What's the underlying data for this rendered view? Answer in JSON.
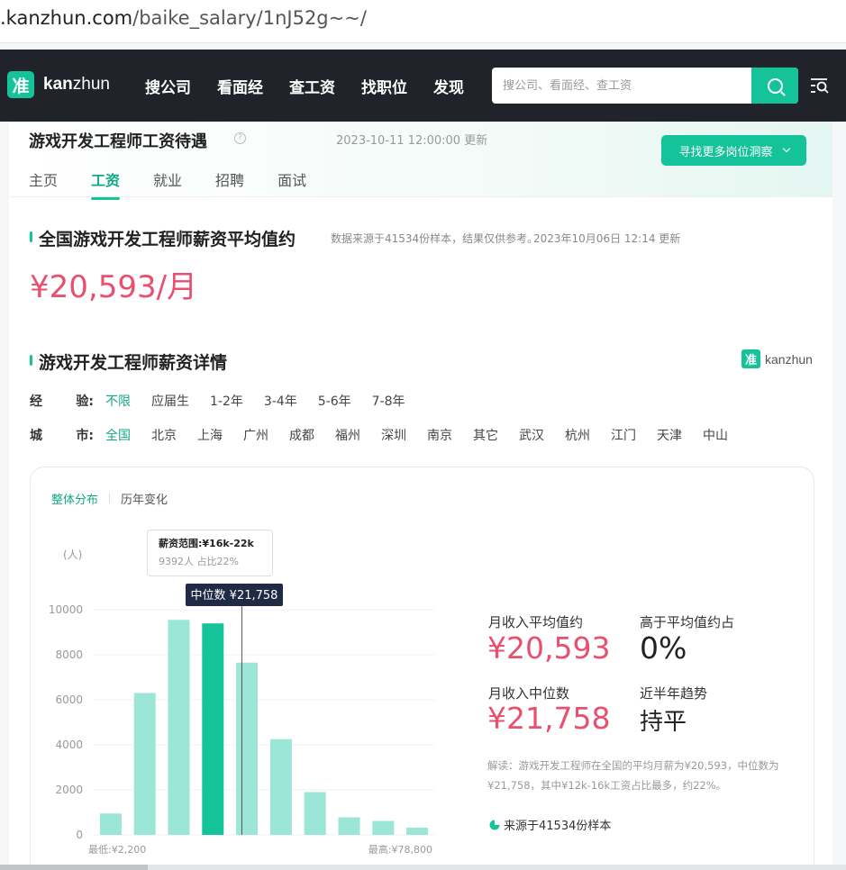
{
  "browser": {
    "url_host": ".kanzhun.com",
    "url_path": "/baike_salary/1nJ52g~~/"
  },
  "nav": {
    "logo_mark": "准",
    "logo_bold": "kan",
    "logo_rest": "zhun",
    "links": [
      "搜公司",
      "看面经",
      "查工资",
      "找职位",
      "发现"
    ],
    "search_placeholder": "搜公司、看面经、查工资"
  },
  "header": {
    "title": "游戏开发工程师工资待遇",
    "update_time": "2023-10-11 12:00:00 更新",
    "more_button": "寻找更多岗位洞察",
    "tabs": [
      {
        "label": "主页",
        "active": false
      },
      {
        "label": "工资",
        "active": true
      },
      {
        "label": "就业",
        "active": false
      },
      {
        "label": "招聘",
        "active": false
      },
      {
        "label": "面试",
        "active": false
      }
    ]
  },
  "average": {
    "title": "全国游戏开发工程师薪资平均值约",
    "note": "数据来源于41534份样本，结果仅供参考。",
    "date": "2023年10月06日 12:14 更新",
    "value": "¥20,593/月"
  },
  "details": {
    "title": "游戏开发工程师薪资详情",
    "brand_mark": "准",
    "brand_text": "kanzhun",
    "experience_label": [
      "经",
      "验:"
    ],
    "experience_options": [
      "不限",
      "应届生",
      "1-2年",
      "3-4年",
      "5-6年",
      "7-8年"
    ],
    "experience_active": 0,
    "city_label": [
      "城",
      "市:"
    ],
    "city_options": [
      "全国",
      "北京",
      "上海",
      "广州",
      "成都",
      "福州",
      "深圳",
      "南京",
      "其它",
      "武汉",
      "杭州",
      "江门",
      "天津",
      "中山"
    ],
    "city_active": 0
  },
  "chart_panel": {
    "subtabs": [
      "整体分布",
      "历年变化"
    ],
    "tooltip_title": "薪资范围:¥16k-22k",
    "tooltip_detail": "9392人 占比22%",
    "median_label": "中位数 ¥21,758",
    "unit_label": "(人)",
    "min_label": "最低:¥2,200",
    "max_label": "最高:¥78,800"
  },
  "chart_data": {
    "type": "bar",
    "ylabel": "(人)",
    "ylim": [
      0,
      10000
    ],
    "yticks": [
      0,
      2000,
      4000,
      6000,
      8000,
      10000
    ],
    "values": [
      950,
      6300,
      9550,
      9392,
      7650,
      4250,
      1900,
      780,
      620,
      320
    ],
    "highlight_index": 3,
    "median_position": 3.85,
    "colors": {
      "bar": "#9be6d6",
      "highlight": "#15c39a",
      "median_line": "#555555"
    }
  },
  "stats": {
    "avg_label": "月收入平均值约",
    "avg_value": "¥20,593",
    "above_label": "高于平均值约占",
    "above_value": "0%",
    "median_label": "月收入中位数",
    "median_value": "¥21,758",
    "trend_label": "近半年趋势",
    "trend_value": "持平",
    "interpretation": "解读：游戏开发工程师在全国的平均月薪为¥20,593，中位数为¥21,758，其中¥12k-16k工资占比最多，约22%。",
    "sample_source": "来源于41534份样本"
  }
}
